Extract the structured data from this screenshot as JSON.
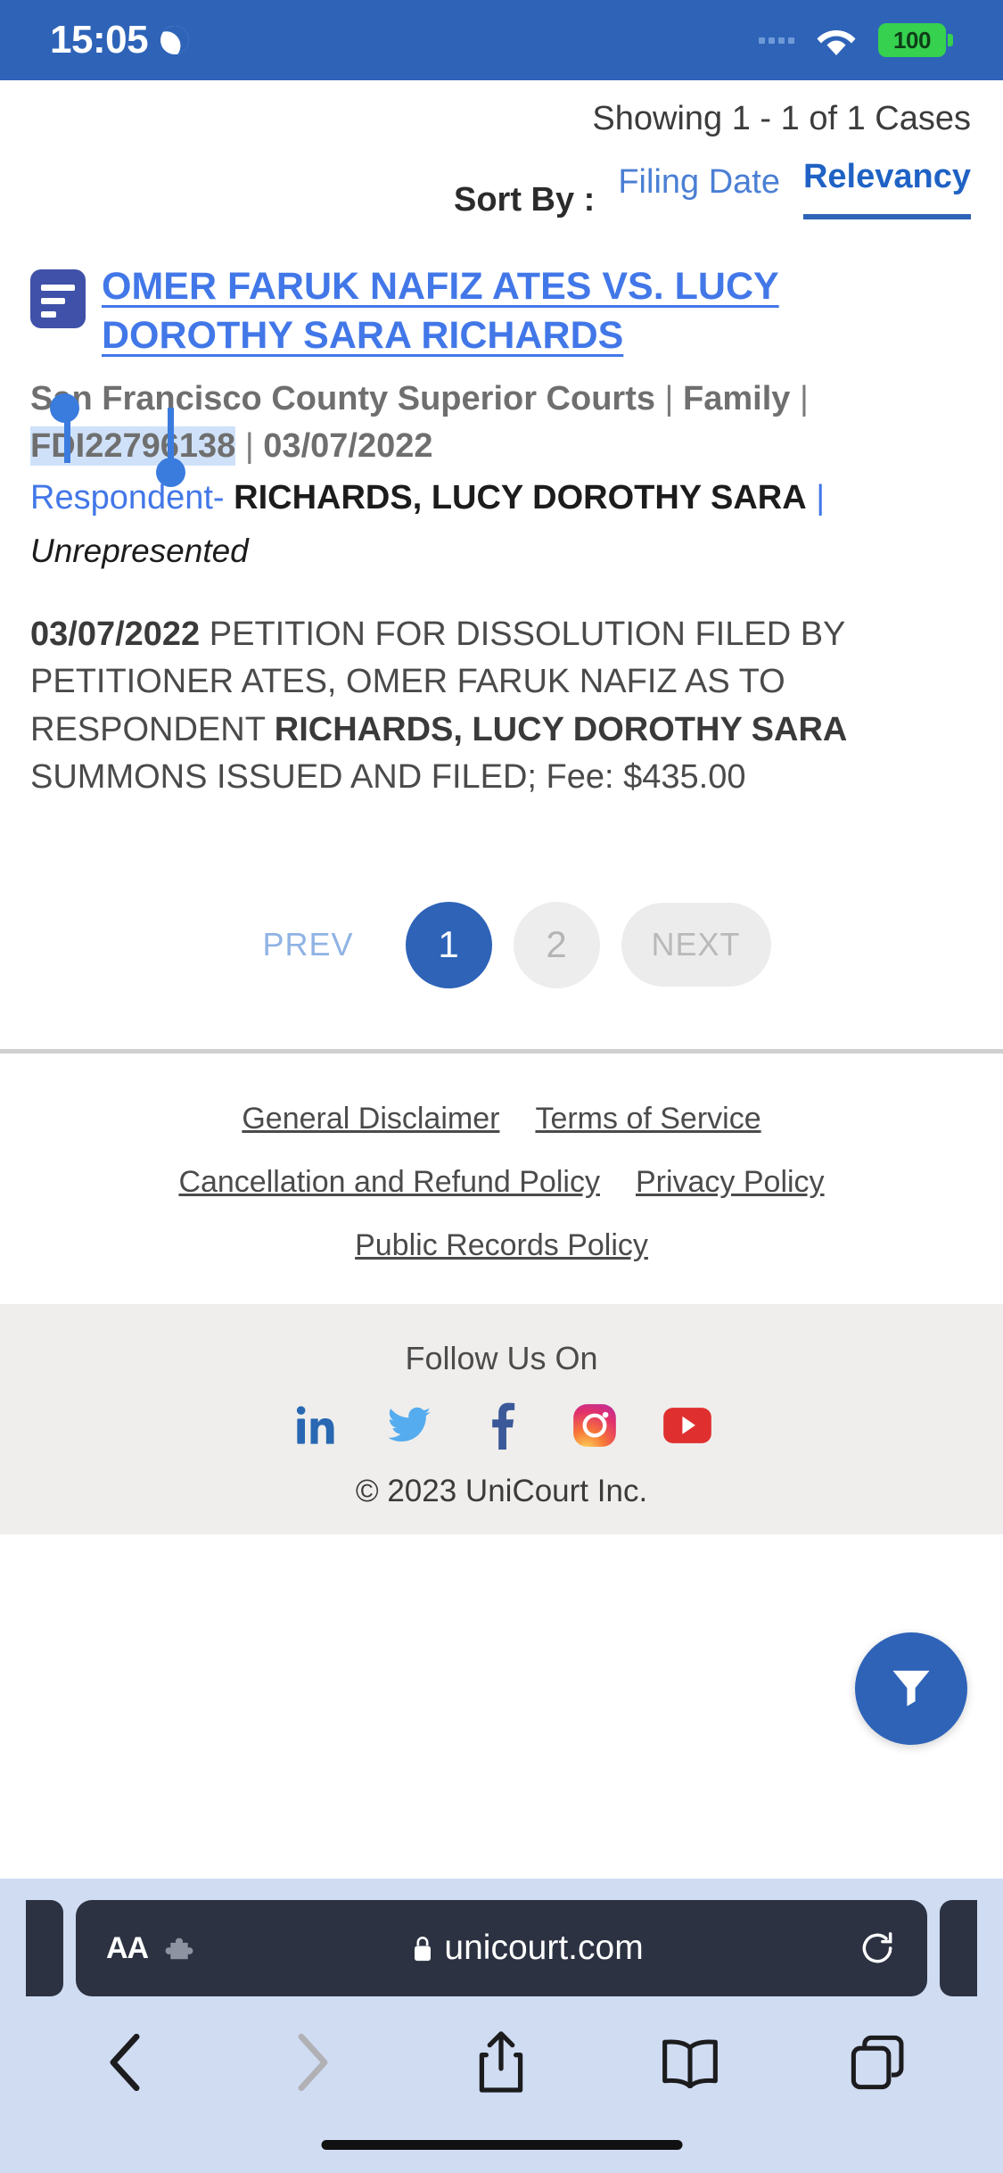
{
  "status_bar": {
    "time": "15:05",
    "moon_icon": "crescent-moon-icon",
    "battery_percent": "100",
    "wifi_icon": "wifi-icon",
    "signal_icon": "signal-dots-icon"
  },
  "results": {
    "showing_text": "Showing 1 - 1 of 1  Cases",
    "sort_by_label": "Sort By :",
    "sort_options": [
      {
        "label": "Filing Date",
        "active": false
      },
      {
        "label": "Relevancy",
        "active": true
      }
    ]
  },
  "case": {
    "icon": "document-lines-icon",
    "title": "OMER FARUK NAFIZ ATES VS. LUCY DOROTHY SARA RICHARDS",
    "court": "San Francisco County Superior Courts",
    "case_type": "Family",
    "case_number": "FDI22796138",
    "filing_date": "03/07/2022",
    "separator": "|",
    "party_role": "Respondent-",
    "party_name": "RICHARDS, LUCY DOROTHY SARA",
    "party_pipe": "|",
    "representation": "Unrepresented",
    "docket_date": "03/07/2022",
    "docket_text_1": "PETITION FOR DISSOLUTION FILED BY PETITIONER ATES, OMER FARUK NAFIZ AS TO RESPONDENT ",
    "docket_respondent": "RICHARDS, LUCY DOROTHY SARA",
    "docket_text_2": " SUMMONS ISSUED AND FILED; Fee: $435.00",
    "selected_text": "FDI22796138"
  },
  "pagination": {
    "prev_label": "PREV",
    "next_label": "NEXT",
    "pages": [
      {
        "label": "1",
        "current": true
      },
      {
        "label": "2",
        "current": false
      }
    ]
  },
  "footer": {
    "links_row1": [
      "General Disclaimer",
      "Terms of Service"
    ],
    "links_row2": [
      "Cancellation and Refund Policy",
      "Privacy Policy"
    ],
    "links_row3": [
      "Public Records Policy"
    ],
    "follow_title": "Follow Us On",
    "social": [
      {
        "name": "linkedin-icon",
        "color": "#2867B2"
      },
      {
        "name": "twitter-icon",
        "color": "#55ACEE"
      },
      {
        "name": "facebook-icon",
        "color": "#3B5998"
      },
      {
        "name": "instagram-icon",
        "color": "#E1306C"
      },
      {
        "name": "youtube-icon",
        "color": "#E02F2F"
      }
    ],
    "copyright": "© 2023 UniCourt Inc.",
    "fab_icon": "filter-funnel-icon"
  },
  "browser": {
    "text_size_label": "AA",
    "extensions_icon": "puzzle-piece-icon",
    "lock_icon": "lock-icon",
    "url": "unicourt.com",
    "reload_icon": "reload-icon",
    "toolbar": [
      {
        "name": "back-icon",
        "enabled": true
      },
      {
        "name": "forward-icon",
        "enabled": false
      },
      {
        "name": "share-icon",
        "enabled": true
      },
      {
        "name": "bookmarks-icon",
        "enabled": true
      },
      {
        "name": "tabs-icon",
        "enabled": true
      }
    ]
  },
  "colors": {
    "status_bar_bg": "#2E63B8",
    "link_blue": "#4277E8",
    "accent_blue": "#2E63B8",
    "selection_bg": "#cfe1f9",
    "selection_handle": "#3A7BDE"
  }
}
